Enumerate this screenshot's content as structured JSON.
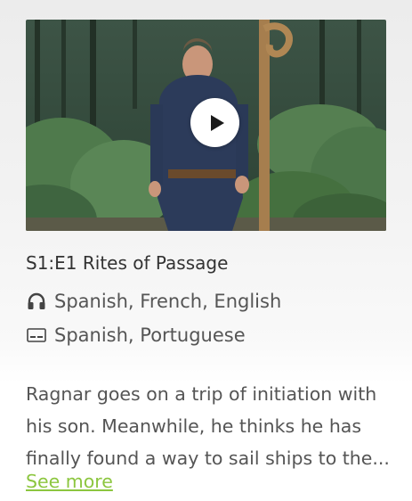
{
  "episode": {
    "title": "S1:E1 Rites of Passage",
    "audio_languages": "Spanish, French, English",
    "subtitle_languages": "Spanish, Portuguese",
    "description_lines": [
      "Ragnar goes on a trip of initiation with",
      "his son. Meanwhile, he thinks he has",
      "finally found a way to sail ships to the..."
    ],
    "see_more_label": "See more"
  },
  "icons": {
    "play": "play-icon",
    "audio": "headphones-icon",
    "subtitles": "subtitles-icon"
  },
  "colors": {
    "accent": "#8cc63f",
    "title_text": "#333333",
    "body_text": "#555555"
  }
}
